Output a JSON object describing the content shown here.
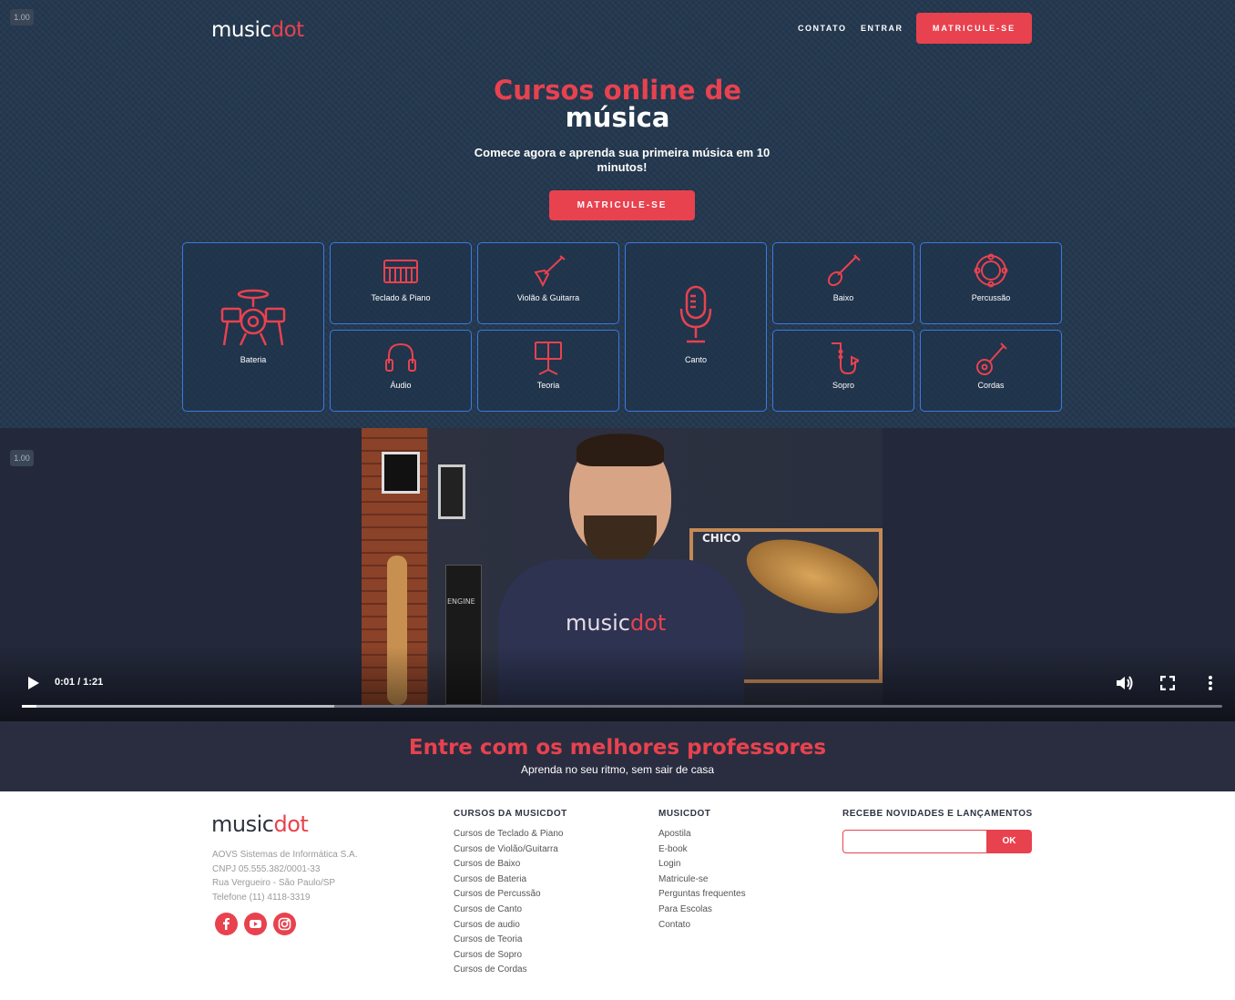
{
  "zoom_badge": "1.00",
  "header": {
    "logo_main": "music",
    "logo_accent": "dot",
    "nav": {
      "contact": "CONTATO",
      "login": "ENTRAR"
    },
    "cta": "MATRICULE-SE"
  },
  "hero": {
    "title_line1": "Cursos online de",
    "title_line2": "música",
    "subtitle": "Comece agora e aprenda sua primeira música em 10 minutos!",
    "cta": "MATRICULE-SE"
  },
  "courses": {
    "bateria": "Bateria",
    "teclado": "Teclado & Piano",
    "violao": "Violão & Guitarra",
    "canto": "Canto",
    "baixo": "Baixo",
    "percussao": "Percussão",
    "audio": "Áudio",
    "teoria": "Teoria",
    "sopro": "Sopro",
    "cordas": "Cordas"
  },
  "video": {
    "zoom_badge": "1.00",
    "time": "0:01 / 1:21",
    "progress": 0.0125,
    "buffered": 0.26,
    "shelf_text": "CHICO",
    "shirt_main": "music",
    "shirt_accent": "dot",
    "amp_text": "ENGINE"
  },
  "teachers": {
    "title": "Entre com os melhores professores",
    "subtitle": "Aprenda no seu ritmo, sem sair de casa"
  },
  "footer": {
    "logo_main": "music",
    "logo_accent": "dot",
    "company": "AOVS Sistemas de Informática S.A.",
    "cnpj": "CNPJ 05.555.382/0001-33",
    "address": "Rua Vergueiro - São Paulo/SP",
    "phone": "Telefone (11) 4118-3319",
    "courses_heading": "CURSOS DA MUSICDOT",
    "courses": [
      "Cursos de Teclado & Piano",
      "Cursos de Violão/Guitarra",
      "Cursos de Baixo",
      "Cursos de Bateria",
      "Cursos de Percussão",
      "Cursos de Canto",
      "Cursos de audio",
      "Cursos de Teoria",
      "Cursos de Sopro",
      "Cursos de Cordas"
    ],
    "musicdot_heading": "MUSICDOT",
    "musicdot_links": [
      "Apostila",
      "E-book",
      "Login",
      "Matricule-se",
      "Perguntas frequentes",
      "Para Escolas",
      "Contato"
    ],
    "newsletter_heading": "RECEBE NOVIDADES E LANÇAMENTOS",
    "newsletter_button": "OK"
  },
  "colors": {
    "accent": "#e8424f",
    "hero_bg": "#24384f",
    "card_border": "#3a7be0",
    "dark_band": "#2a2d40"
  }
}
